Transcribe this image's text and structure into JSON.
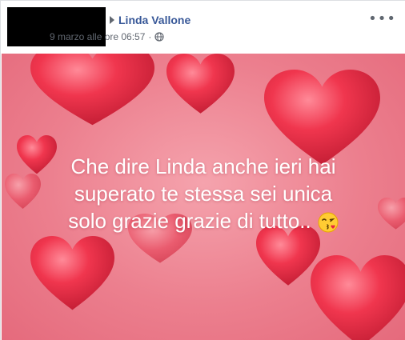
{
  "post": {
    "author_name": "Linda Vallone",
    "timestamp": "9 marzo alle ore 06:57",
    "separator": "·",
    "privacy_icon": "globe-icon",
    "more_label": "•••",
    "arrow_icon": "arrow-right-icon",
    "text_lines": [
      "Che dire Linda anche ieri hai",
      "superato te stessa sei unica",
      "solo grazie grazie di tutto.."
    ],
    "emoji_icon": "kissing-face-icon",
    "colors": {
      "author": "#385898",
      "meta": "#616770",
      "background": "#ec7f8e",
      "hearts": "#e8324a"
    }
  }
}
